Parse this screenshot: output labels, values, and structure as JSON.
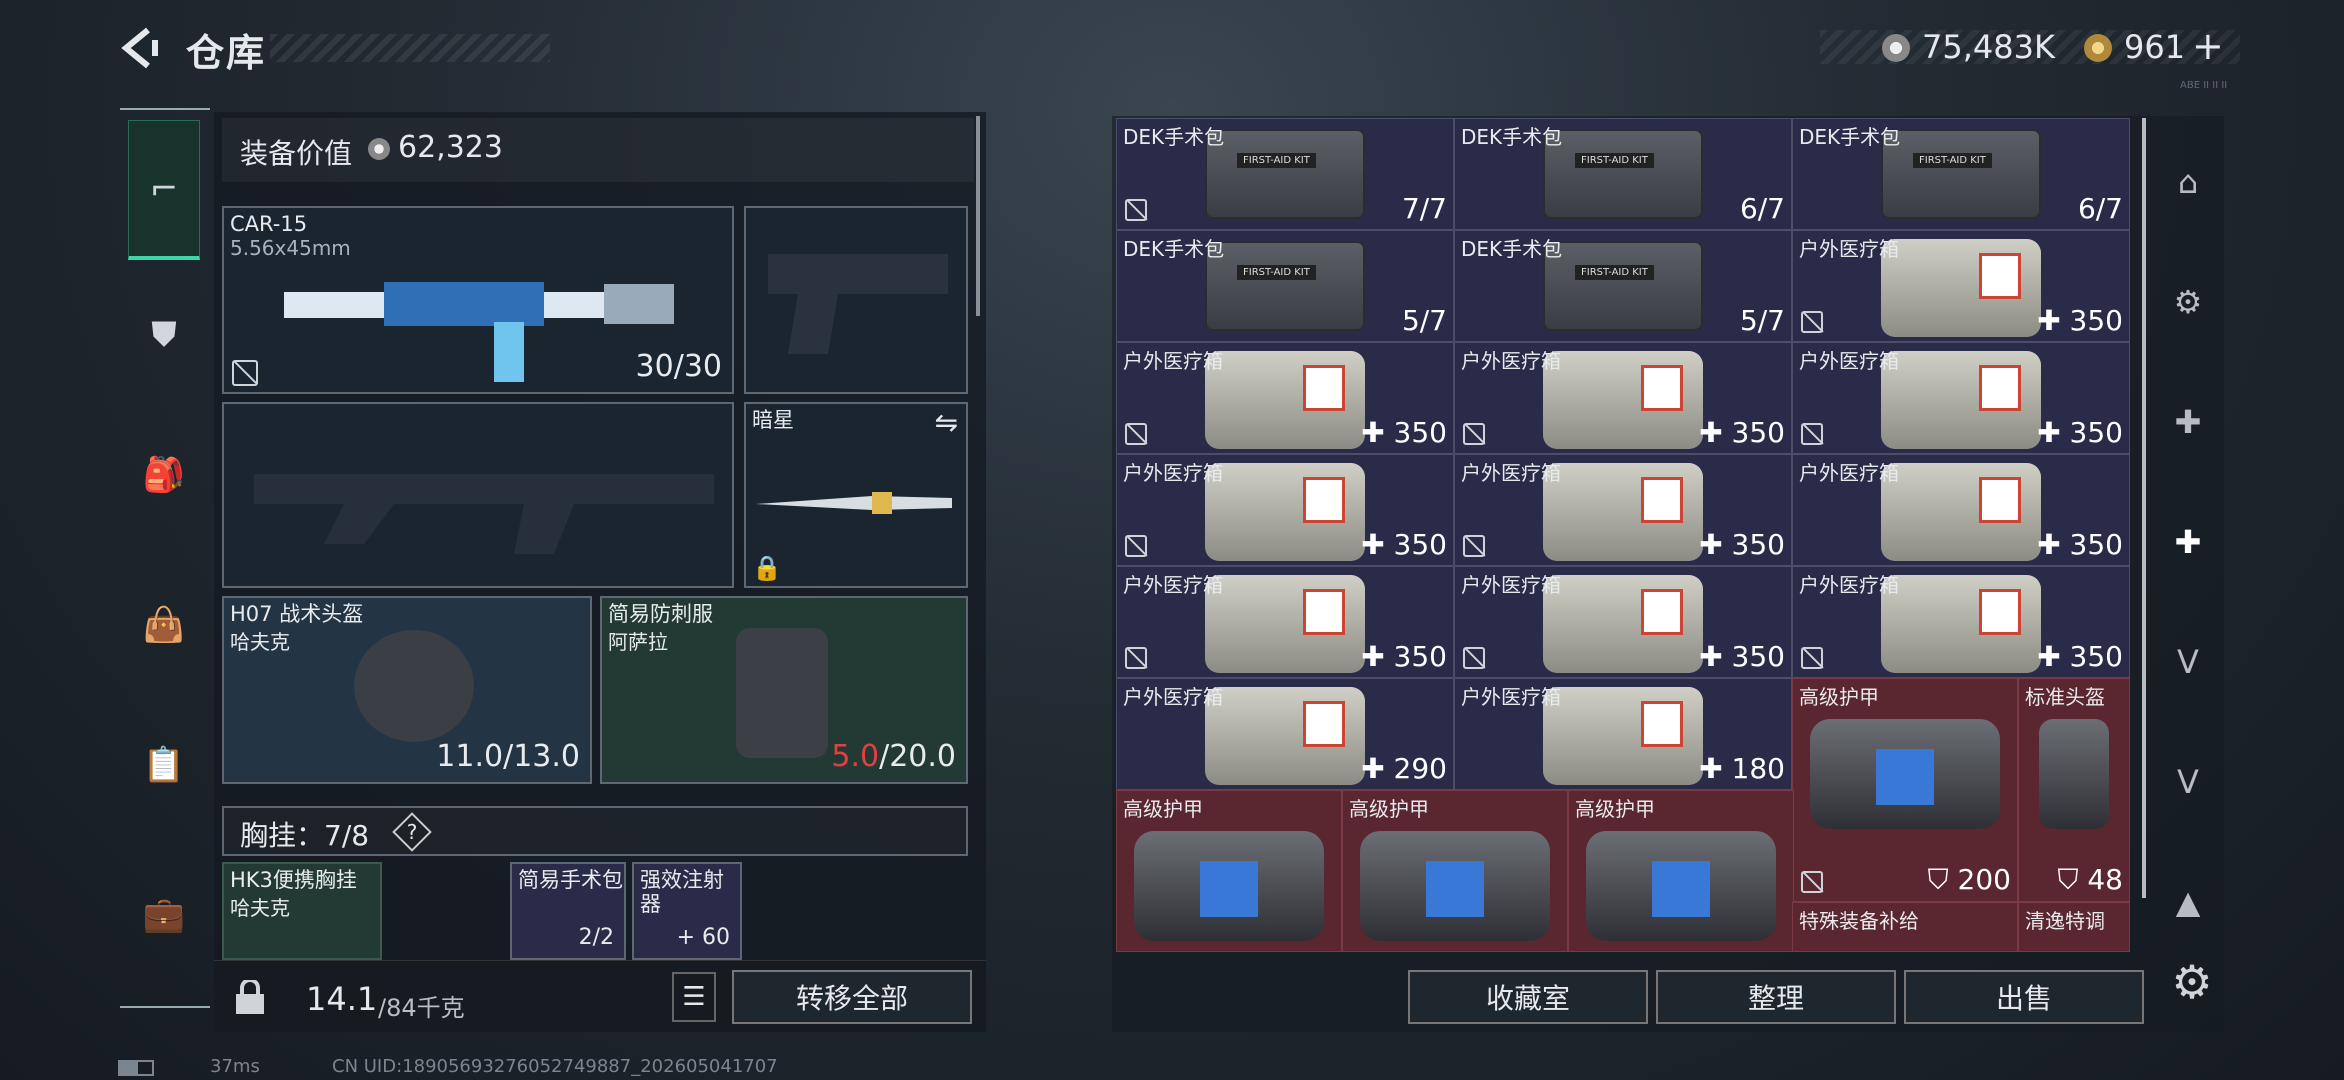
{
  "header": {
    "title": "仓库",
    "currency1": "75,483K",
    "currency2": "961",
    "add": "+",
    "tiny": "ABE II II II"
  },
  "equipment": {
    "value_label": "装备价值",
    "value": "62,323",
    "primary": {
      "name": "CAR-15",
      "caliber": "5.56x45mm",
      "ammo": "30/30"
    },
    "melee": {
      "name": "暗星"
    },
    "helmet": {
      "name": "H07 战术头盔",
      "origin": "哈夫克",
      "durability": "11.0/13.0"
    },
    "armor": {
      "name": "简易防刺服",
      "origin": "阿萨拉",
      "durability_cur": "5.0",
      "durability_max": "/20.0"
    },
    "chest": {
      "label": "胸挂：7/8",
      "help": "?"
    },
    "rig": {
      "name": "HK3便携胸挂",
      "origin": "哈夫克"
    },
    "pouch": {
      "name": "简易手术包",
      "count": "2/2"
    },
    "injector": {
      "name": "强效注射器",
      "count": "+ 60"
    }
  },
  "weight": {
    "current": "14.1",
    "max": "/84千克"
  },
  "buttons": {
    "transfer_all": "转移全部",
    "collection": "收藏室",
    "organize": "整理",
    "sell": "出售"
  },
  "inventory": [
    {
      "name": "DEK手术包",
      "count": "7/7",
      "type": "pouch",
      "nodrop": true
    },
    {
      "name": "DEK手术包",
      "count": "6/7",
      "type": "pouch",
      "nodrop": false
    },
    {
      "name": "DEK手术包",
      "count": "6/7",
      "type": "pouch",
      "nodrop": false
    },
    {
      "name": "DEK手术包",
      "count": "5/7",
      "type": "pouch",
      "nodrop": false
    },
    {
      "name": "DEK手术包",
      "count": "5/7",
      "type": "pouch",
      "nodrop": false
    },
    {
      "name": "户外医疗箱",
      "count": "✚ 350",
      "type": "med",
      "nodrop": true
    },
    {
      "name": "户外医疗箱",
      "count": "✚ 350",
      "type": "med",
      "nodrop": true
    },
    {
      "name": "户外医疗箱",
      "count": "✚ 350",
      "type": "med",
      "nodrop": true
    },
    {
      "name": "户外医疗箱",
      "count": "✚ 350",
      "type": "med",
      "nodrop": true
    },
    {
      "name": "户外医疗箱",
      "count": "✚ 350",
      "type": "med",
      "nodrop": true
    },
    {
      "name": "户外医疗箱",
      "count": "✚ 350",
      "type": "med",
      "nodrop": true
    },
    {
      "name": "户外医疗箱",
      "count": "✚ 350",
      "type": "med",
      "nodrop": false
    },
    {
      "name": "户外医疗箱",
      "count": "✚ 350",
      "type": "med",
      "nodrop": true
    },
    {
      "name": "户外医疗箱",
      "count": "✚ 350",
      "type": "med",
      "nodrop": true
    },
    {
      "name": "户外医疗箱",
      "count": "✚ 350",
      "type": "med",
      "nodrop": true
    },
    {
      "name": "户外医疗箱",
      "count": "✚ 290",
      "type": "med",
      "nodrop": false
    },
    {
      "name": "户外医疗箱",
      "count": "✚ 180",
      "type": "med",
      "nodrop": false
    },
    {
      "name": "高级护甲",
      "count": "⛉ 200",
      "type": "bag",
      "nodrop": true
    },
    {
      "name": "标准头盔",
      "count": "⛉ 48",
      "type": "helm",
      "nodrop": false
    },
    {
      "name": "高级护甲",
      "count": "",
      "type": "bag",
      "nodrop": false
    },
    {
      "name": "高级护甲",
      "count": "",
      "type": "bag",
      "nodrop": false
    },
    {
      "name": "高级护甲",
      "count": "",
      "type": "bag",
      "nodrop": false
    },
    {
      "name": "特殊装备补给",
      "count": "",
      "type": "none",
      "nodrop": false
    },
    {
      "name": "清逸特调",
      "count": "",
      "type": "none",
      "nodrop": false
    }
  ],
  "status": {
    "ping": "37ms",
    "uid": "CN UID:18905693276052749887_202605041707"
  },
  "colors": {
    "accent": "#3fd6a6",
    "grid_bg": "#2a2b48",
    "rare_red": "#5a2630",
    "warn": "#e04040"
  },
  "icons": {
    "back": "back-arrow-icon",
    "settings": "gear-icon"
  }
}
